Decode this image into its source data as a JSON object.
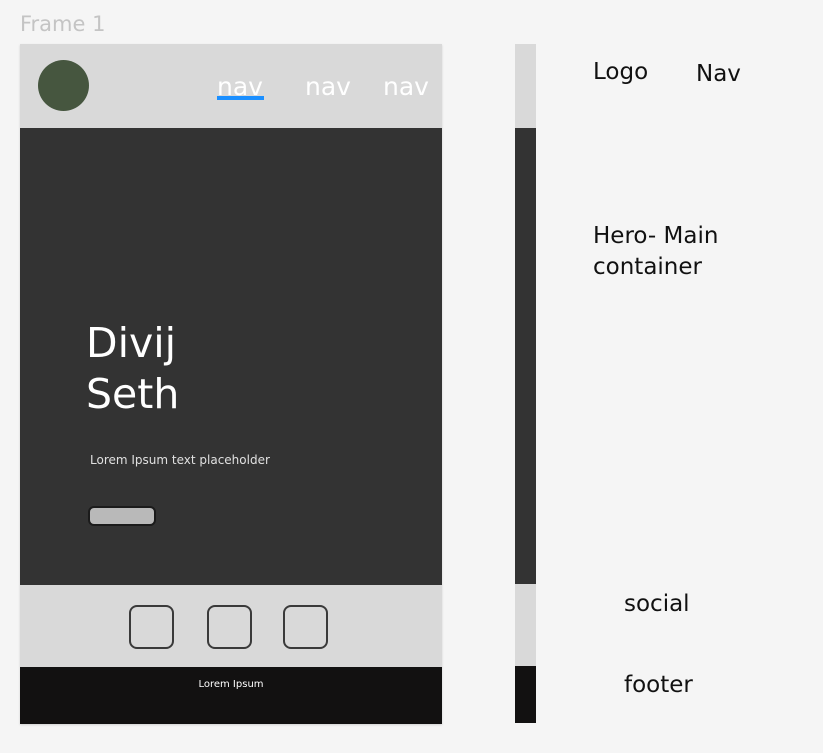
{
  "frame_label": "Frame 1",
  "header": {
    "nav_items": [
      "nav",
      "nav",
      "nav"
    ],
    "active_index": 0,
    "colors": {
      "background": "#d9d9d9",
      "logo": "#46563f",
      "active_underline": "#1b8fff"
    }
  },
  "hero": {
    "name_line1": "Divij",
    "name_line2": "Seth",
    "subtitle": "Lorem Ipsum text placeholder",
    "colors": {
      "background": "#333333",
      "button": "#b9b9b9"
    }
  },
  "social": {
    "icons": [
      "social-box-icon",
      "social-box-icon",
      "social-box-icon"
    ],
    "colors": {
      "background": "#d9d9d9"
    }
  },
  "footer": {
    "text": "Lorem Ipsum",
    "colors": {
      "background": "#121111"
    }
  },
  "annotations": {
    "logo": "Logo",
    "nav": "Nav",
    "hero": "Hero- Main container",
    "social": "social",
    "footer": "footer"
  }
}
